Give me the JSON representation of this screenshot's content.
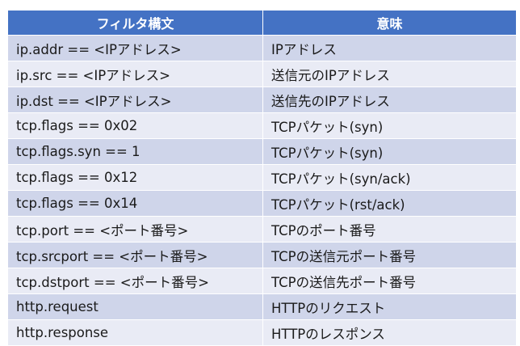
{
  "table": {
    "headers": [
      "フィルタ構文",
      "意味"
    ],
    "rows": [
      [
        "ip.addr == <IPアドレス>",
        "IPアドレス"
      ],
      [
        "ip.src == <IPアドレス>",
        "送信元のIPアドレス"
      ],
      [
        "ip.dst == <IPアドレス>",
        "送信先のIPアドレス"
      ],
      [
        "tcp.flags == 0x02",
        "TCPパケット(syn)"
      ],
      [
        "tcp.flags.syn == 1",
        "TCPパケット(syn)"
      ],
      [
        "tcp.flags == 0x12",
        "TCPパケット(syn/ack)"
      ],
      [
        "tcp.flags == 0x14",
        "TCPパケット(rst/ack)"
      ],
      [
        "tcp.port == <ポート番号>",
        "TCPのポート番号"
      ],
      [
        "tcp.srcport == <ポート番号>",
        "TCPの送信元ポート番号"
      ],
      [
        "tcp.dstport == <ポート番号>",
        "TCPの送信先ポート番号"
      ],
      [
        "http.request",
        "HTTPのリクエスト"
      ],
      [
        "http.response",
        "HTTPのレスポンス"
      ]
    ]
  },
  "colors": {
    "header_bg": "#4472c4",
    "header_text": "#ffffff",
    "row_odd": "#cfd5ea",
    "row_even": "#e9ebf5"
  }
}
